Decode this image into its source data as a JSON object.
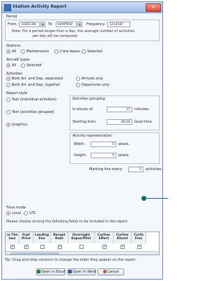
{
  "window": {
    "title": "Station Activity Report"
  },
  "period": {
    "heading": "Period",
    "from_label": "From:",
    "from_value": "31DEC08",
    "to_label": "To:",
    "to_value": "04APR09",
    "frequency_label": "Frequency:",
    "frequency_value": "1234567",
    "note_line1": "Note: For a period longer than a day, the average number of activities",
    "note_line2": "per day will be computed."
  },
  "stations": {
    "heading": "Stations",
    "options": [
      "All",
      "Maintenance",
      "Crew bases",
      "Selected"
    ],
    "selected": "All"
  },
  "aircraft_types": {
    "heading": "Aircraft types",
    "options": [
      "All",
      "Selected"
    ],
    "selected": "All"
  },
  "activities": {
    "heading": "Activities",
    "options": [
      "Both Arr. and Dep. separated",
      "Arrivals only",
      "Both Arr. and Dep. together",
      "Departures only"
    ],
    "selected": "Both Arr. and Dep. separated"
  },
  "report_style": {
    "heading": "Report style",
    "options": [
      "Text (individual activities)",
      "Text (activities grouped)",
      "Graphics"
    ],
    "selected": "Graphics"
  },
  "activities_grouping": {
    "heading": "Activities grouping",
    "blocks_label": "In blocks of:",
    "blocks_value": "15",
    "blocks_unit": "minutes.",
    "starting_label": "Starting from:",
    "starting_value": "00:00",
    "starting_unit": "local time."
  },
  "activity_representation": {
    "heading": "Activity representation",
    "width_label": "Width:",
    "width_value": "5",
    "width_unit": "pixels.",
    "height_label": "Height:",
    "height_value": "5",
    "height_unit": "pixels."
  },
  "marking": {
    "label": "Marking line every:",
    "value": "5",
    "unit": "activities."
  },
  "time_mode": {
    "heading": "Time mode",
    "options": [
      "Local",
      "UTC"
    ],
    "selected": "Local"
  },
  "fields": {
    "instructions": "Please choose among the following fields to be included in the report:",
    "columns": [
      {
        "label1": "ro Tim",
        "label2": "lass",
        "checked": true
      },
      {
        "label1": "Fuel",
        "label2": "Price",
        "checked": true
      },
      {
        "label1": "Landing",
        "label2": "Fee",
        "checked": false
      },
      {
        "label1": "Recapt",
        "label2": "Rate",
        "checked": true
      },
      {
        "label1": "Overnight",
        "label2": "Expos/Pilot",
        "checked": false
      },
      {
        "label1": "Curfew",
        "label2": "Effect",
        "checked": true
      },
      {
        "label1": "Curfew",
        "label2": "Discnt",
        "checked": true
      },
      {
        "label1": "Curfe",
        "label2": "Frec",
        "checked": true
      }
    ],
    "tip": "Tip: Drag and drop columns to change the order they appear on the report."
  },
  "buttons": {
    "excel": "Open in Excel",
    "word": "Open in Word",
    "cancel": "Cancel"
  },
  "colors": {
    "title_bar": "#9bbbe6",
    "radio_selected": "#e0542c",
    "close_button": "#d24b36",
    "callout": "#0a6b6f"
  }
}
